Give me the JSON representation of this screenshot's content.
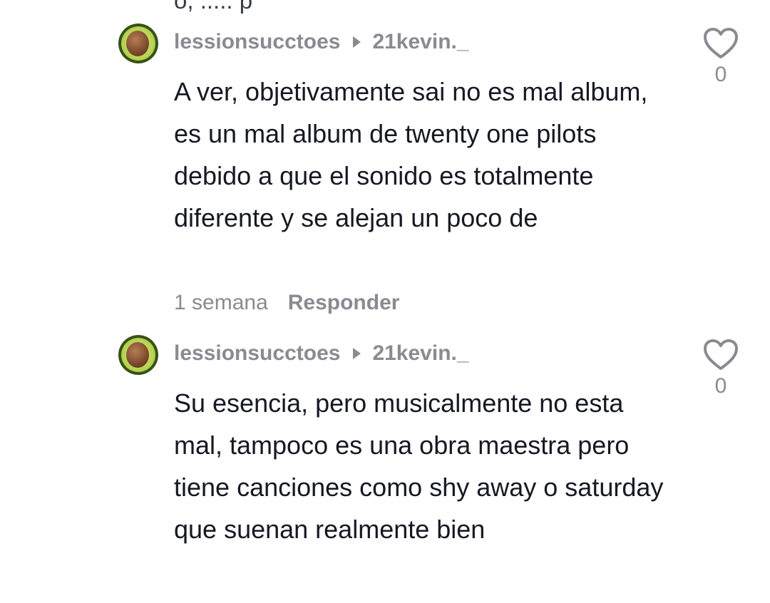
{
  "cut_off_text": "o, ..... p",
  "comments": [
    {
      "username": "lessionsucctoes",
      "reply_to": "21kevin._",
      "text": "A ver, objetivamente sai no es mal album, es un mal album de twenty one pilots debido a que el sonido es totalmente diferente y se alejan un poco de",
      "time": "1 semana",
      "reply_label": "Responder",
      "likes": "0"
    },
    {
      "username": "lessionsucctoes",
      "reply_to": "21kevin._",
      "text": "Su esencia, pero musicalmente no esta mal, tampoco es una obra maestra pero tiene canciones como shy away o saturday que suenan realmente bien",
      "likes": "0"
    }
  ],
  "colors": {
    "primary_text": "#161823",
    "secondary_text": "#8a8b91"
  },
  "icons": {
    "avatar": "avocado-avatar",
    "reply_arrow": "play-arrow-icon",
    "like": "heart-outline-icon"
  }
}
